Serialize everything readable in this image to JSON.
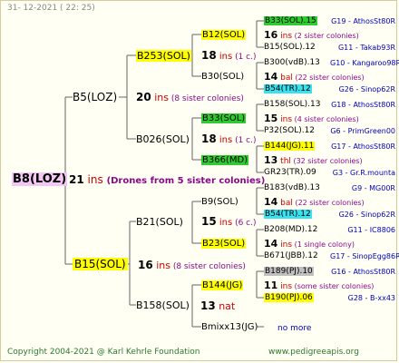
{
  "date": "31- 12-2021 ( 22: 25)",
  "colors": {
    "yellow": "#ffff00",
    "green": "#2ecc2e",
    "cyan": "#39e2f0",
    "gray": "#c0c0c0",
    "blue": "#0000bb",
    "red": "#cc0000",
    "purple": "#8a0a8a",
    "line": "#666666",
    "footer": "#2a7a2a"
  },
  "root": {
    "name": "B8(LOZ)",
    "ins": "21",
    "ins_word": "ins",
    "note": "(Drones from 5 sister colonies)"
  },
  "gen2": [
    {
      "name": "B5(LOZ)"
    },
    {
      "name": "B15(SOL)",
      "ins": "16",
      "ins_word": "ins",
      "note": "(8 sister colonies)"
    }
  ],
  "gen3": [
    {
      "name": "B253(SOL)",
      "ins": "20",
      "ins_word": "ins",
      "note": "(8 sister colonies)"
    },
    {
      "name": "B026(SOL)",
      "ins": "",
      "ins_word": "",
      "note": ""
    },
    {
      "name": "B21(SOL)",
      "ins": "",
      "ins_word": "",
      "note": ""
    },
    {
      "name": "B158(SOL)",
      "ins": "13",
      "ins_word": "nat",
      "note": ""
    }
  ],
  "gen4": [
    {
      "name": "B12(SOL)",
      "ins": "18",
      "ins_word": "ins",
      "note": "(1 c.)"
    },
    {
      "name": "B30(SOL)",
      "ins": "",
      "ins_word": "",
      "note": ""
    },
    {
      "name": "B33(SOL)",
      "ins": "18",
      "ins_word": "ins",
      "note": "(1 c.)"
    },
    {
      "name": "B366(MD)",
      "ins": "",
      "ins_word": "",
      "note": ""
    },
    {
      "name": "B9(SOL)",
      "ins": "15",
      "ins_word": "ins",
      "note": "(6 c.)"
    },
    {
      "name": "B23(SOL)",
      "ins": "",
      "ins_word": "",
      "note": ""
    },
    {
      "name": "B144(JG)",
      "ins": "",
      "ins_word": "",
      "note": ""
    },
    {
      "name": "Bmixx13(JG)",
      "ins": "",
      "ins_word": "",
      "note": "no more"
    }
  ],
  "gen5": [
    {
      "name": "B33(SOL).15",
      "code": "G19 - AthosSt80R"
    },
    {
      "num": "16",
      "word": "ins",
      "note": "(2 sister colonies)"
    },
    {
      "name": "B15(SOL).12",
      "code": "G11 - Takab93R"
    },
    {
      "name": "B300(vdB).13",
      "code": "G10 - Kangaroo98R"
    },
    {
      "num": "14",
      "word": "bal",
      "note": "(22 sister colonies)"
    },
    {
      "name": "B54(TR).12",
      "code": "G26 - Sinop62R"
    },
    {
      "name": "B158(SOL).13",
      "code": "G18 - AthosSt80R"
    },
    {
      "num": "15",
      "word": "ins",
      "note": "(4 sister colonies)"
    },
    {
      "name": "P32(SOL).12",
      "code": "G6 - PrimGreen00"
    },
    {
      "name": "B144(JG).11",
      "code": "G17 - AthosSt80R"
    },
    {
      "num": "13",
      "word": "thl",
      "note": "(32 sister colonies)"
    },
    {
      "name": "GR23(TR).09",
      "code": "G3 - Gr.R.mounta"
    },
    {
      "name": "B183(vdB).13",
      "code": "G9 - MG00R"
    },
    {
      "num": "14",
      "word": "bal",
      "note": "(22 sister colonies)"
    },
    {
      "name": "B54(TR).12",
      "code": "G26 - Sinop62R"
    },
    {
      "name": "B208(MD).12",
      "code": "G11 - IC8806"
    },
    {
      "num": "14",
      "word": "ins",
      "note": "(1 single colony)"
    },
    {
      "name": "B671(JBB).12",
      "code": "G17 - SinopEgg86R"
    },
    {
      "name": "B189(PJ).10",
      "code": "G16 - AthosSt80R"
    },
    {
      "num": "11",
      "word": "ins",
      "note": "(some sister colonies)"
    },
    {
      "name": "B190(PJ).06",
      "code": "G28 - B-xx43"
    }
  ],
  "footer": {
    "copyright": "Copyright 2004-2021 @ Karl Kehrle Foundation",
    "site": "www.pedigreeapis.org"
  }
}
